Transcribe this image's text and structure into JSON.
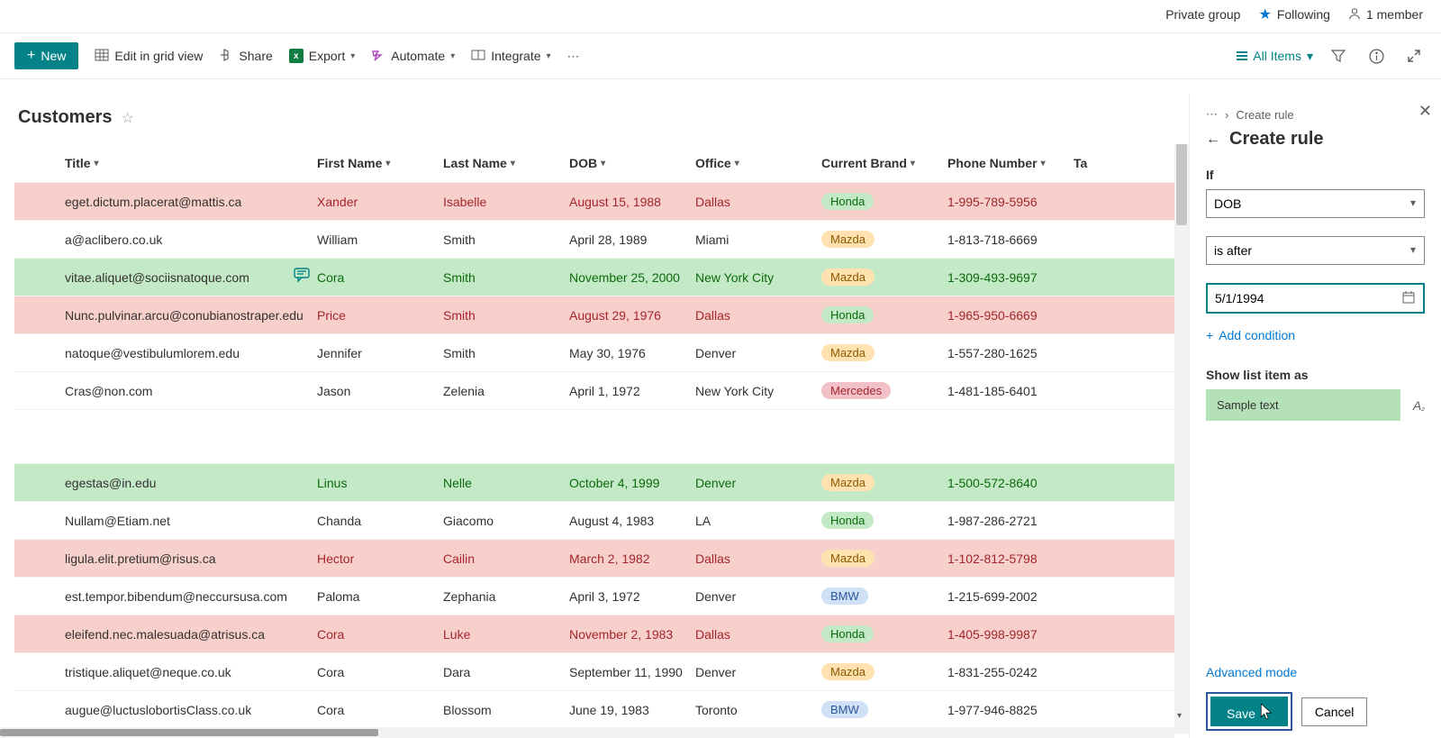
{
  "topbar": {
    "group": "Private group",
    "following": "Following",
    "members": "1 member"
  },
  "cmdbar": {
    "new": "New",
    "edit_grid": "Edit in grid view",
    "share": "Share",
    "export": "Export",
    "automate": "Automate",
    "integrate": "Integrate",
    "all_items": "All Items"
  },
  "list": {
    "title": "Customers",
    "columns": [
      "Title",
      "First Name",
      "Last Name",
      "DOB",
      "Office",
      "Current Brand",
      "Phone Number",
      "Ta"
    ],
    "rows": [
      {
        "title": "eget.dictum.placerat@mattis.ca",
        "first": "Xander",
        "last": "Isabelle",
        "dob": "August 15, 1988",
        "office": "Dallas",
        "brand": "Honda",
        "phone": "1-995-789-5956",
        "hl": "red",
        "comment": false
      },
      {
        "title": "a@aclibero.co.uk",
        "first": "William",
        "last": "Smith",
        "dob": "April 28, 1989",
        "office": "Miami",
        "brand": "Mazda",
        "phone": "1-813-718-6669",
        "hl": "none",
        "comment": false
      },
      {
        "title": "vitae.aliquet@sociisnatoque.com",
        "first": "Cora",
        "last": "Smith",
        "dob": "November 25, 2000",
        "office": "New York City",
        "brand": "Mazda",
        "phone": "1-309-493-9697",
        "hl": "green",
        "comment": true
      },
      {
        "title": "Nunc.pulvinar.arcu@conubianostraper.edu",
        "first": "Price",
        "last": "Smith",
        "dob": "August 29, 1976",
        "office": "Dallas",
        "brand": "Honda",
        "phone": "1-965-950-6669",
        "hl": "red",
        "comment": false
      },
      {
        "title": "natoque@vestibulumlorem.edu",
        "first": "Jennifer",
        "last": "Smith",
        "dob": "May 30, 1976",
        "office": "Denver",
        "brand": "Mazda",
        "phone": "1-557-280-1625",
        "hl": "none",
        "comment": false
      },
      {
        "title": "Cras@non.com",
        "first": "Jason",
        "last": "Zelenia",
        "dob": "April 1, 1972",
        "office": "New York City",
        "brand": "Mercedes",
        "phone": "1-481-185-6401",
        "hl": "none",
        "comment": false
      },
      {
        "spacer": true
      },
      {
        "title": "egestas@in.edu",
        "first": "Linus",
        "last": "Nelle",
        "dob": "October 4, 1999",
        "office": "Denver",
        "brand": "Mazda",
        "phone": "1-500-572-8640",
        "hl": "green",
        "comment": false
      },
      {
        "title": "Nullam@Etiam.net",
        "first": "Chanda",
        "last": "Giacomo",
        "dob": "August 4, 1983",
        "office": "LA",
        "brand": "Honda",
        "phone": "1-987-286-2721",
        "hl": "none",
        "comment": false
      },
      {
        "title": "ligula.elit.pretium@risus.ca",
        "first": "Hector",
        "last": "Cailin",
        "dob": "March 2, 1982",
        "office": "Dallas",
        "brand": "Mazda",
        "phone": "1-102-812-5798",
        "hl": "red",
        "comment": false
      },
      {
        "title": "est.tempor.bibendum@neccursusa.com",
        "first": "Paloma",
        "last": "Zephania",
        "dob": "April 3, 1972",
        "office": "Denver",
        "brand": "BMW",
        "phone": "1-215-699-2002",
        "hl": "none",
        "comment": false
      },
      {
        "title": "eleifend.nec.malesuada@atrisus.ca",
        "first": "Cora",
        "last": "Luke",
        "dob": "November 2, 1983",
        "office": "Dallas",
        "brand": "Honda",
        "phone": "1-405-998-9987",
        "hl": "red",
        "comment": false
      },
      {
        "title": "tristique.aliquet@neque.co.uk",
        "first": "Cora",
        "last": "Dara",
        "dob": "September 11, 1990",
        "office": "Denver",
        "brand": "Mazda",
        "phone": "1-831-255-0242",
        "hl": "none",
        "comment": false
      },
      {
        "title": "augue@luctuslobortisClass.co.uk",
        "first": "Cora",
        "last": "Blossom",
        "dob": "June 19, 1983",
        "office": "Toronto",
        "brand": "BMW",
        "phone": "1-977-946-8825",
        "hl": "none",
        "comment": false
      }
    ]
  },
  "panel": {
    "breadcrumb": "Create rule",
    "title": "Create rule",
    "if": "If",
    "column": "DOB",
    "condition": "is after",
    "value": "5/1/1994",
    "add_cond": "Add condition",
    "show_as": "Show list item as",
    "sample": "Sample text",
    "advanced": "Advanced mode",
    "save": "Save",
    "cancel": "Cancel"
  },
  "brand_class": {
    "Honda": "honda",
    "Mazda": "mazda",
    "Mercedes": "merc",
    "BMW": "bmw"
  }
}
